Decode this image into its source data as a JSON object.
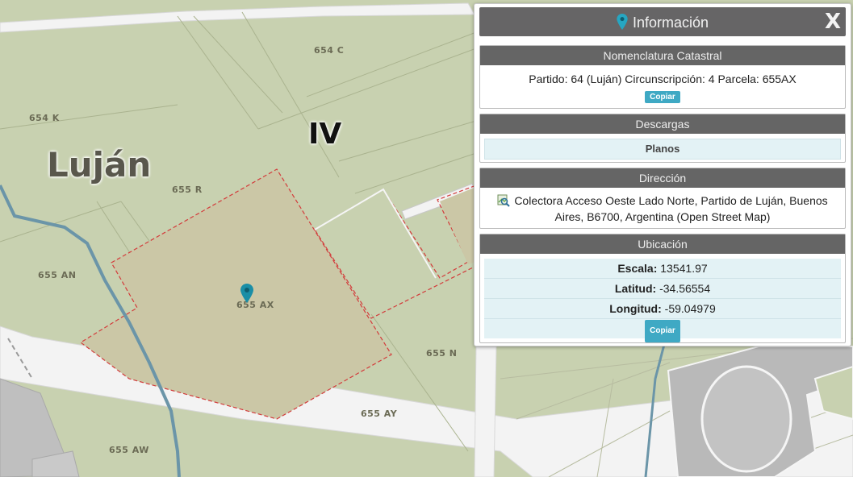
{
  "map": {
    "town_label": "Luján",
    "circunscripcion_label": "IV",
    "parcel_labels": [
      "654 C",
      "654 K",
      "655 R",
      "655 AN",
      "655 AX",
      "655 N",
      "655 AY",
      "655 AW"
    ],
    "colors": {
      "terrain": "#c8d1b0",
      "parcel_fill": "#cbc7a6",
      "parcel_border": "#d33b3b",
      "river": "#6b95a8",
      "road": "#f2f2f2",
      "pin": "#1a8ea6"
    }
  },
  "panel": {
    "title": "Información",
    "title_icon": "map-pin-icon",
    "close_label": "X",
    "nomenclatura": {
      "heading": "Nomenclatura Catastral",
      "text": "Partido: 64 (Luján) Circunscripción: 4 Parcela: 655AX",
      "copy_label": "Copiar"
    },
    "descargas": {
      "heading": "Descargas",
      "planos_label": "Planos"
    },
    "direccion": {
      "heading": "Dirección",
      "icon": "map-search-icon",
      "text": "Colectora Acceso Oeste Lado Norte, Partido de Luján, Buenos Aires, B6700, Argentina (Open Street Map)"
    },
    "ubicacion": {
      "heading": "Ubicación",
      "escala_label": "Escala:",
      "escala_value": "13541.97",
      "latitud_label": "Latitud:",
      "latitud_value": "-34.56554",
      "longitud_label": "Longitud:",
      "longitud_value": "-59.04979",
      "copy_label": "Copiar"
    }
  }
}
